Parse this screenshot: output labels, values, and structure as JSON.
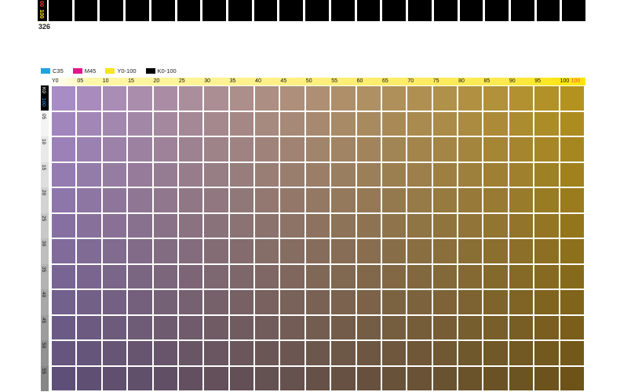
{
  "top": {
    "axis_labels": [
      "00",
      "100"
    ],
    "page_number": "326"
  },
  "legend": [
    {
      "label": "C35",
      "color": "#1fa3dc"
    },
    {
      "label": "M45",
      "color": "#e0168c"
    },
    {
      "label": "Y0-100",
      "color": "#f7e51c"
    },
    {
      "label": "K0-100",
      "color": "#000000"
    }
  ],
  "columns": {
    "first_label": "Y0",
    "labels": [
      "05",
      "10",
      "15",
      "20",
      "25",
      "30",
      "35",
      "40",
      "45",
      "50",
      "55",
      "60",
      "65",
      "70",
      "75",
      "80",
      "85",
      "90",
      "95",
      "100"
    ],
    "last_secondary": "100"
  },
  "rows": {
    "corner_label": "K0",
    "corner_sub": "100",
    "labels": [
      "05",
      "10",
      "15",
      "20",
      "25",
      "30",
      "35",
      "40",
      "45",
      "50",
      "55"
    ]
  },
  "colors": {
    "grid_top_left": "#a88cc5",
    "grid_top_right": "#b39220",
    "grid_bottom_left": "#5e4f78",
    "grid_bottom_right": "#6d5318"
  }
}
